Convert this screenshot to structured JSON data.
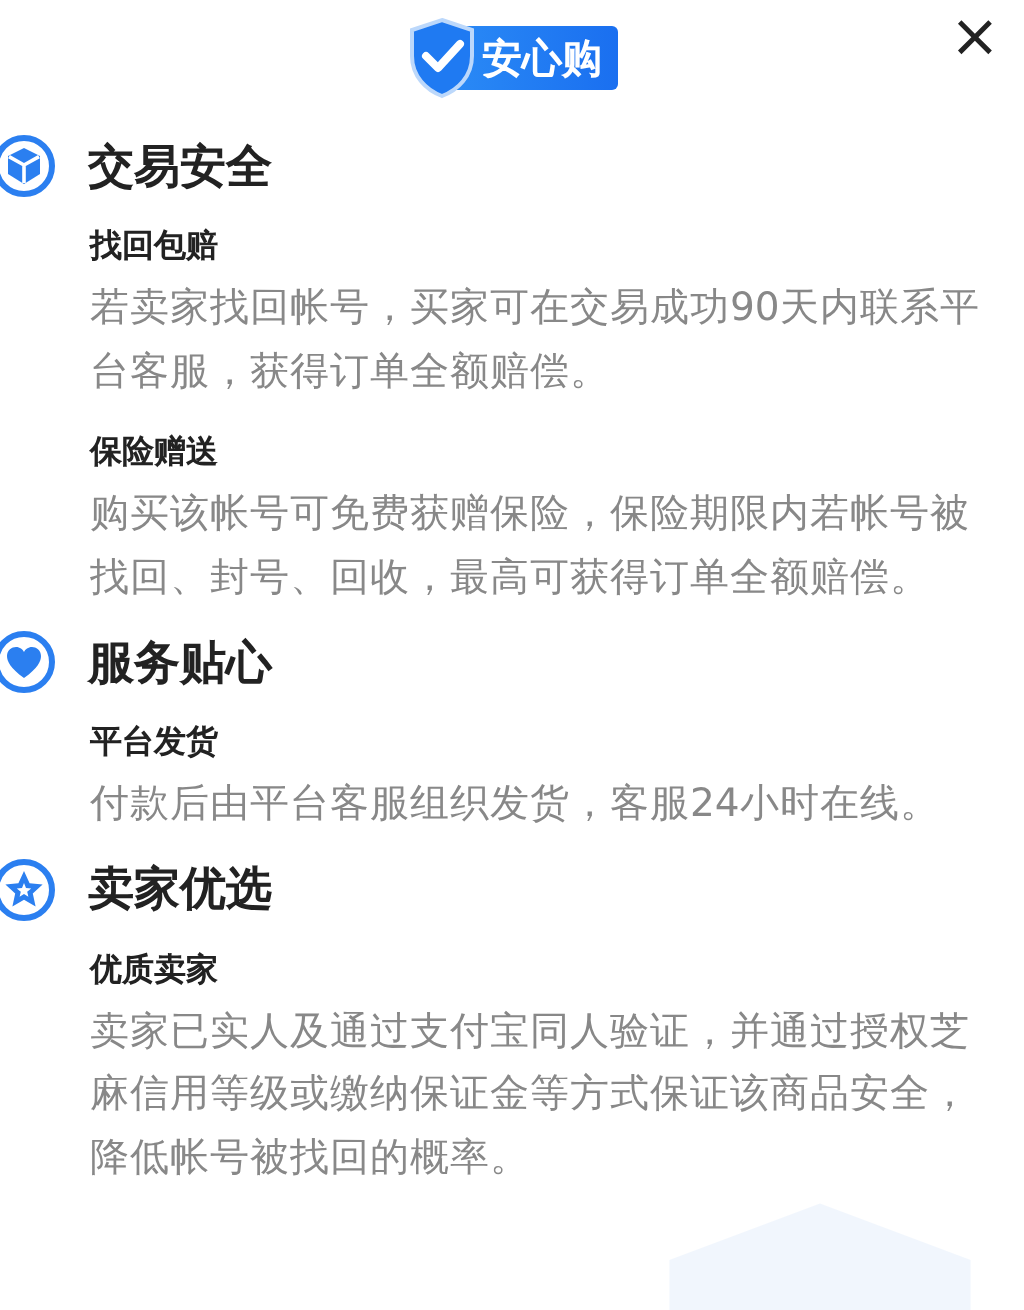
{
  "badge": {
    "text": "安心购"
  },
  "close": {
    "text": "×"
  },
  "sections": [
    {
      "kind": "cube",
      "title": "交易安全",
      "items": [
        {
          "title": "找回包赔",
          "text": "若卖家找回帐号，买家可在交易成功90天内联系平台客服，获得订单全额赔偿。"
        },
        {
          "title": "保险赠送",
          "text": "购买该帐号可免费获赠保险，保险期限内若帐号被找回、封号、回收，最高可获得订单全额赔偿。"
        }
      ]
    },
    {
      "kind": "heart",
      "title": "服务贴心",
      "items": [
        {
          "title": "平台发货",
          "text": "付款后由平台客服组织发货，客服24小时在线。"
        }
      ]
    },
    {
      "kind": "star",
      "title": "卖家优选",
      "items": [
        {
          "title": "优质卖家",
          "text": "卖家已实人及通过支付宝同人验证，并通过授权芝麻信用等级或缴纳保证金等方式保证该商品安全，降低帐号被找回的概率。"
        }
      ]
    }
  ]
}
